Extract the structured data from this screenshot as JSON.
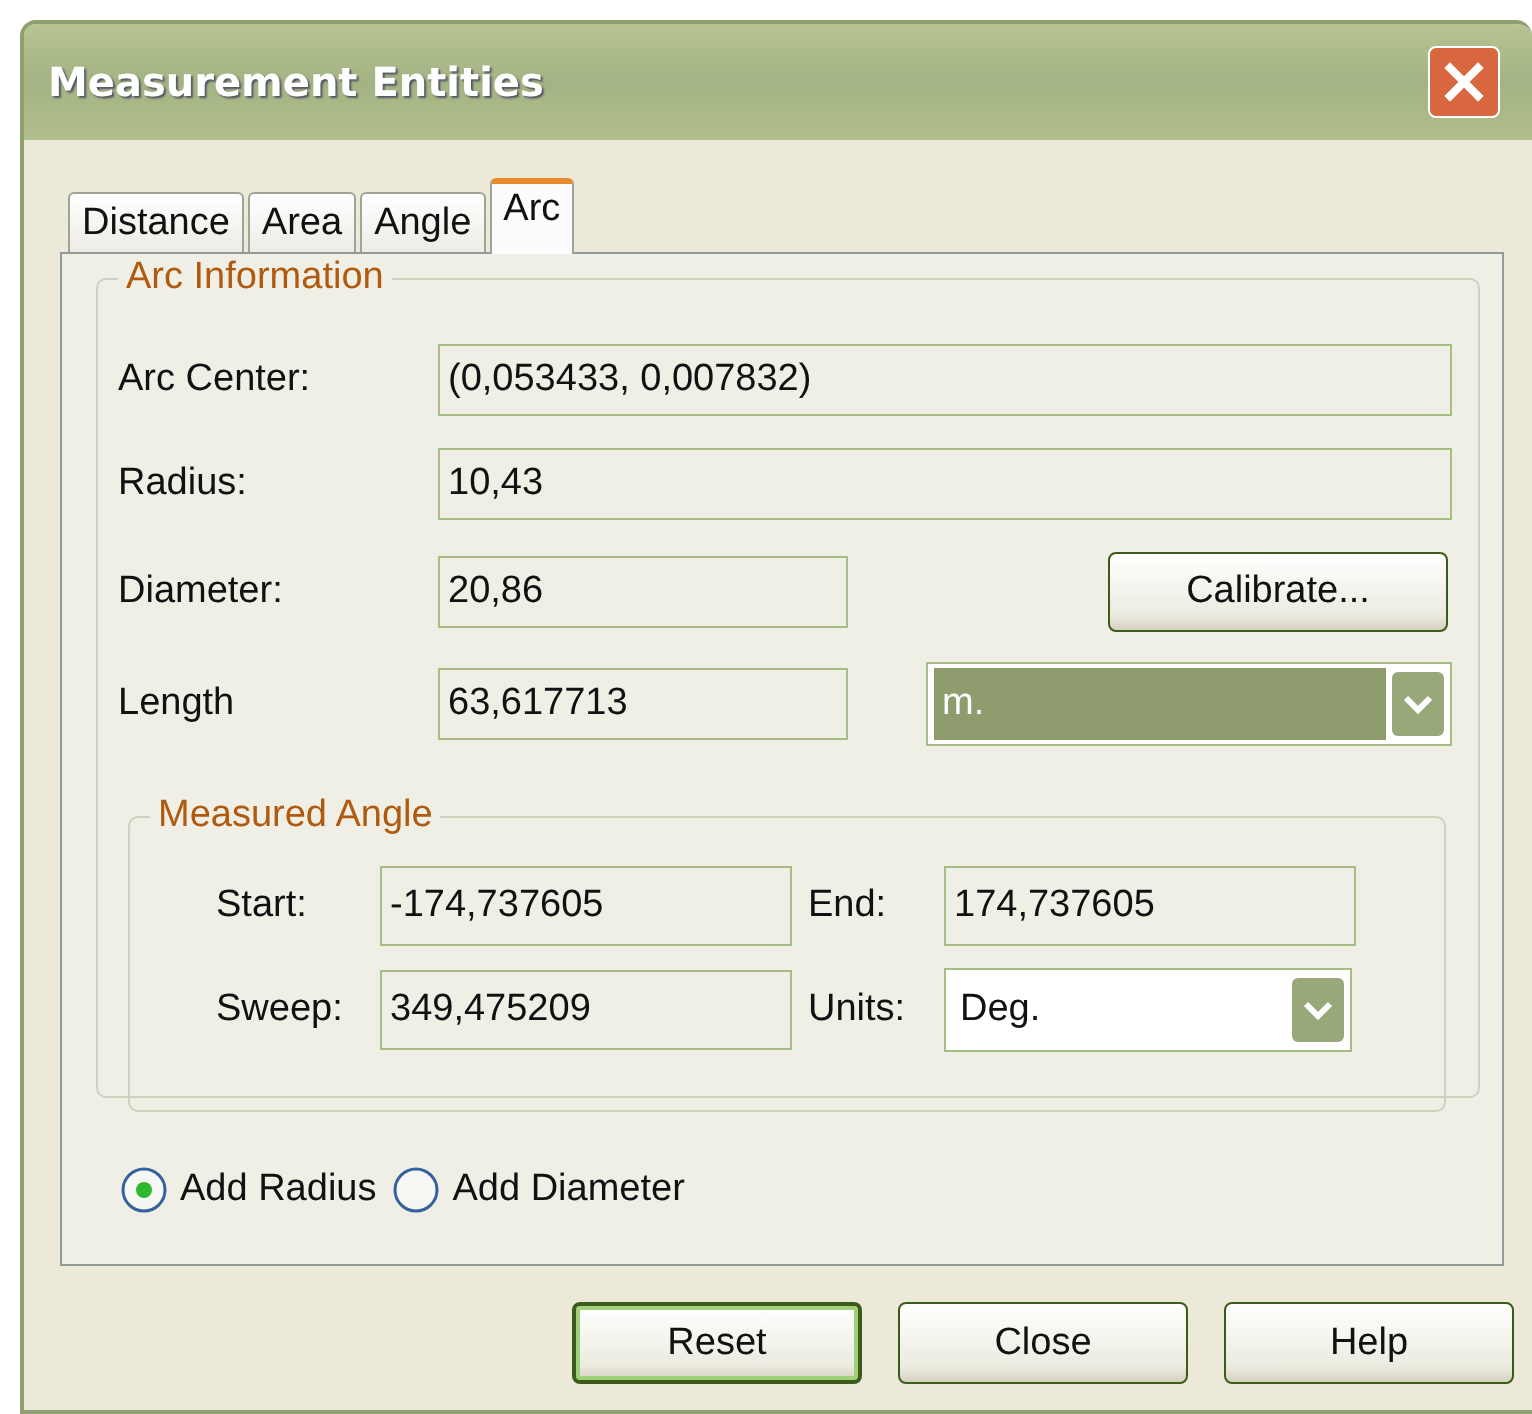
{
  "window": {
    "title": "Measurement Entities"
  },
  "tabs": [
    {
      "label": "Distance",
      "selected": false
    },
    {
      "label": "Area",
      "selected": false
    },
    {
      "label": "Angle",
      "selected": false
    },
    {
      "label": "Arc",
      "selected": true
    }
  ],
  "arc_information": {
    "title": "Arc Information",
    "fields": [
      {
        "kind": "wide",
        "label": "Arc Center:",
        "value": "(0,053433, 0,007832)"
      },
      {
        "kind": "wide",
        "label": "Radius:",
        "value": "10,43"
      },
      {
        "kind": "button",
        "label": "Diameter:",
        "value": "20,86"
      },
      {
        "kind": "combo",
        "label": "Length",
        "value": "63,617713"
      }
    ],
    "calibrate_button": "Calibrate...",
    "length_units": {
      "value": "m.",
      "highlighted": true
    }
  },
  "measured_angle": {
    "title": "Measured Angle",
    "start": {
      "label": "Start:",
      "value": "-174,737605"
    },
    "end": {
      "label": "End:",
      "value": "174,737605"
    },
    "sweep": {
      "label": "Sweep:",
      "value": "349,475209"
    },
    "units": {
      "label": "Units:",
      "value": "Deg.",
      "highlighted": false
    }
  },
  "radios": [
    {
      "label": "Add Radius",
      "selected": true
    },
    {
      "label": "Add Diameter",
      "selected": false
    }
  ],
  "buttons": [
    {
      "label": "Reset",
      "default": true
    },
    {
      "label": "Close",
      "default": false
    },
    {
      "label": "Help",
      "default": false
    }
  ]
}
